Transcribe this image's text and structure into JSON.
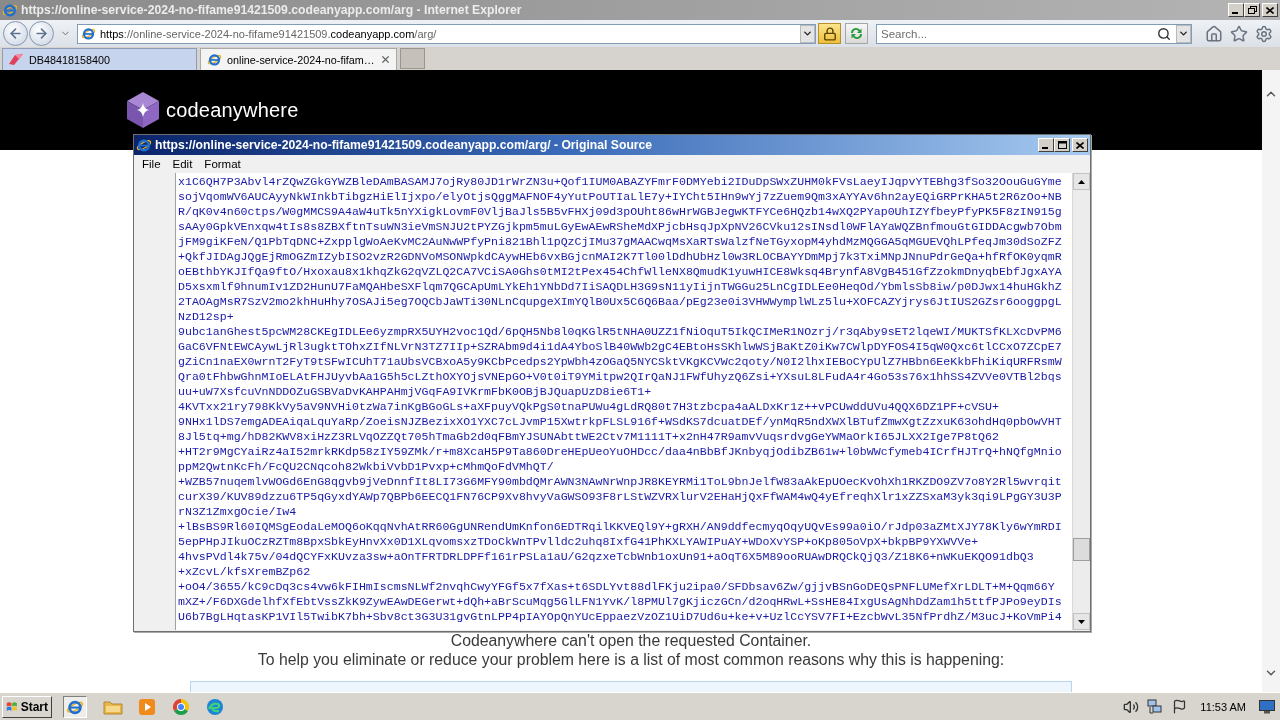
{
  "browser": {
    "title": "https://online-service-2024-no-fifame91421509.codeanyapp.com/arg - Internet Explorer",
    "address": [
      {
        "text": "https",
        "strong": true
      },
      {
        "text": "://online-service-2024-no-fifame91421509.",
        "strong": false
      },
      {
        "text": "codeanyapp.com",
        "strong": true
      },
      {
        "text": "/arg/",
        "strong": false
      }
    ],
    "search": {
      "placeholder": "Search..."
    }
  },
  "tabs": [
    {
      "label": "DB48418158400",
      "kind": "favicon",
      "selected": false
    },
    {
      "label": "online-service-2024-no-fifam…",
      "kind": "browser",
      "selected": true
    }
  ],
  "page": {
    "logo_text": "codeanywhere",
    "messages": [
      "Codeanywhere can't open the requested Container.",
      "To help you eliminate or reduce your problem here is a list of most common reasons why this is happening:"
    ]
  },
  "source_window": {
    "title": "https://online-service-2024-no-fifame91421509.codeanyapp.com/arg/ - Original Source",
    "menu": [
      "File",
      "Edit",
      "Format"
    ],
    "lines": [
      "x1C6QH7P3Abvl4rZQwZGkGYWZBleDAmBASAMJ7ojRy80JD1rWrZN3u+Qof1IUM0ABAZYFmrF0DMYebi2IDuDpSWxZUHM0kFVsLaeyIJqpvYTEBhg3fSo32OouGuGYme",
      "sojVqomWV6AUCAyyNkWInkbTibgzHiElIjxpo/elyOtjsQggMAFNOF4yYutPoUTIaLlE7y+IYCht5IHn9wYj7zZuem9Qm3xAYYAv6hn2ayEQiGRPrKHA5t2R6zOo+NB",
      "R/qK0v4n60ctps/W0gMMCS9A4aW4uTk5nYXigkLovmF0VljBaJls5B5vFHXj09d3pOUht86wHrWGBJegwKTFYCe6HQzb14wXQ2PYap0UhIZYfbeyPfyPK5F8zIN915g",
      "sAAy0GpkVEnxqw4tIs8s8ZBXftnTsuWN3ieVmSNJU2tPYZGjkpm5muLGyEwAEwRSheMdXPjcbHsqJpXpNV26CVku12sINsdl0WFlAYaWQZBnfmouGtGIDDAcgwb7Obm",
      "jFM9giKFeN/Q1PbTqDNC+ZxpplgWoAeKvMC2AuNwWPfyPni821Bhl1pQzCjIMu37gMAACwqMsXaRTsWalzfNeTGyxopM4yhdMzMQGGA5qMGUEVQhLPfeqJm30dSoZFZ",
      "+QkfJIDAgJQgEjRmOGZmIZybISO2vzR2GDNVoMSONWpkdCAywHEb6vxBGjcnMAI2K7Tl00lDdhUbHzl0w3RLOCBAYYDmMpj7k3TxiMNpJNnuPdrGeQa+hfRfOK0yqmR",
      "oEBthbYKJIfQa9ftO/Hxoxau8x1khqZkG2qVZLQ2CA7VCiSA0Ghs0tMI2tPex454ChfWlleNX8QmudK1yuwHICE8Wksq4BrynfA8VgB451GfZzokmDnyqbEbfJgxAYA",
      "D5xsxmlf9hnumIv1ZD2HunU7FaMQAHbeSXFlqm7QGCApUmLYkEh1YNbDd7IiSAQDLH3G9sN11yIijnTWGGu25LnCgIDLEe0HeqOd/YbmlsSb8iw/p0DJwx14huHGkhZ",
      "2TAOAgMsR7SzV2mo2khHuHhy7OSAJi5eg7OQCbJaWTi30NLnCqupgeXImYQlB0Ux5C6Q6Baa/pEg23e0i3VHWWymplWLz5lu+XOFCAZYjrys6JtIUS2GZsr6ooggpgL",
      "NzD12sp+",
      "9ubc1anGhest5pcWM28CKEgIDLEe6yzmpRX5UYH2voc1Qd/6pQH5Nb8l0qKGlR5tNHA0UZZ1fNiOquT5IkQCIMeR1NOzrj/r3qAby9sET2lqeWI/MUKTSfKLXcDvPM6",
      "GaC6VFNtEWCAywLjRl3ugktTOhxZIfNLVrN3TZ7IIp+SZRAbm9d4i1dA4YboSlB40WWb2gC4EBtoHsSKhlwWSjBaKtZ0iKw7CWlpDYFOS4I5qW0Qxc6tlCCxO7ZCpE7",
      "gZiCn1naEX0wrnT2FyT9tSFwICUhT71aUbsVCBxoA5y9KCbPcedps2YpWbh4zOGaQ5NYCSktVKgKCVWc2qoty/N0I2lhxIEBoCYpUlZ7HBbn6EeKkbFhiKiqURFRsmW",
      "Qra0tFhbwGhnMIoELAtFHJUyvbAa1G5h5cLZthOXYOjsVNEpGO+V0t0iT9YMitpw2QIrQaNJ1FWfUhyzQ6Zsi+YXsuL8LFudA4r4Go53s76x1hhSS4ZVVe0VTBl2bqs",
      "uu+uW7XsfcuVnNDDOZuGSBVaDvKAHPAHmjVGqFA9IVKrmFbK0OBjBJQuapUzD8ie6T1+",
      "4KVTxx21ry798KkVy5aV9NVHi0tzWa7inKgBGoGLs+aXFpuyVQkPgS0tnaPUWu4gLdRQ80t7H3tzbcpa4aALDxKr1z++vPCUwddUVu4QQX6DZ1PF+cVSU+",
      "9NHx1lDS7emgADEAiqaLquYaRp/ZoeisNJZBezixXO1YXC7cLJvmP15XwtrkpFLSL916f+WSdKS7dcuatDEf/ynMqR5ndXWXlBTufZmwXgtZzxuK63ohdHq0pbOwVHT",
      "8Jl5tq+mg/hD82KWV8xiHzZ3RLVqOZZQt705hTmaGb2d0qFBmYJSUNAbttWE2Ctv7M1111T+x2nH47R9amvVuqsrdvgGeYWMaOrkI65JLXX2Ige7P8tQ62",
      "+HT2r9MgCYaiRz4aI52mrkRKdp58zIY59ZMk/r+m8XcaH5P9Ta860DreHEpUeoYuOHDcc/daa4nBbBfJKnbyqjOdibZB61w+l0bWWcfymeb4ICrfHJTrQ+hNQfgMnio",
      "ppM2QwtnKcFh/FcQU2CNqcoh82WkbiVvbD1Pvxp+cMhmQoFdVMhQT/",
      "+WZB57nuqemlvWOGd6EnG8qgvb9jVeDnnfIt8LI73G6MFY90mbdQMrAWN3NAwNrWnpJR8KEYRMi1ToL9bnJelfW83aAkEpUOecKvOhXh1RKZDO9ZV7o8Y2Rl5wvrqit",
      "curX39/KUV89dzzu6TP5qGyxdYAWp7QBPb6EECQ1FN76CP9Xv8hvyVaGWSO93F8rLStWZVRXlurV2EHaHjQxFfWAM4wQ4yEfreqhXlr1xZZSxaM3yk3qi9LPgGY3U3P",
      "rN3Z1ZmxgOcie/Iw4",
      "+lBsBS9Rl60IQMSgEodaLeMOQ6oKqqNvhAtRR60GgUNRendUmKnfon6EDTRqilKKVEQl9Y+gRXH/AN9ddfecmyqOqyUQvEs99a0iO/rJdp03aZMtXJY78Kly6wYmRDI",
      "5epPHpJIkuOCzRZTm8BpxSbkEyHnvXx0D1XLqvomsxzTDoCkWnTPvlldc2uhq8IxfG41PhKXLYAWIPuAY+WDoXvYSP+oKp805oVpX+bkpBP9YXWVVe+",
      "4hvsPVdl4k75v/04dQCYFxKUvza3sw+aOnTFRTDRLDPFf161rPSLa1aU/G2qzxeTcbWnb1oxUn91+aOqT6X5M89ooRUAwDRQCkQjQ3/Z18K6+nWKuEKQO91dbQ3",
      "+xZcvL/kfsXremBZp62",
      "+oO4/3655/kC9cDq3cs4vw6kFIHmIscmsNLWf2nvqhCwyYFGf5x7fXas+t6SDLYvt88dlFKju2ipa0/SFDbsav6Zw/gjjvBSnGoDEQsPNFLUMefXrLDLT+M+Qqm66Y",
      "mXZ+/F6DXGdelhfXfEbtVssZkK9ZywEAwDEGerwt+dQh+aBrScuMqg5GlLFN1YvK/l8PMUl7gKjiczGCn/d2oqHRwL+SsHE84IxgUsAgNhDdZam1h5ttfPJPo9eyDIs",
      "U6b7BgLHqtasKP1VIl5TwibK7bh+Sbv8ct3G3U31gvGtnLPP4pIAYOpQnYUcEppaezVzOZ1UiD7Ud6u+ke+v+UzlCcYSV7FI+EzcbWvL35NfPrdhZ/M3ucJ+KoVmPi4"
    ]
  },
  "taskbar": {
    "start": "Start",
    "apps": [
      {
        "kind": "browser",
        "selected": true
      },
      {
        "kind": "folder",
        "selected": false
      },
      {
        "kind": "player",
        "selected": false
      },
      {
        "kind": "ring",
        "selected": false
      },
      {
        "kind": "wave",
        "selected": false
      }
    ],
    "clock": "11:53 AM"
  }
}
